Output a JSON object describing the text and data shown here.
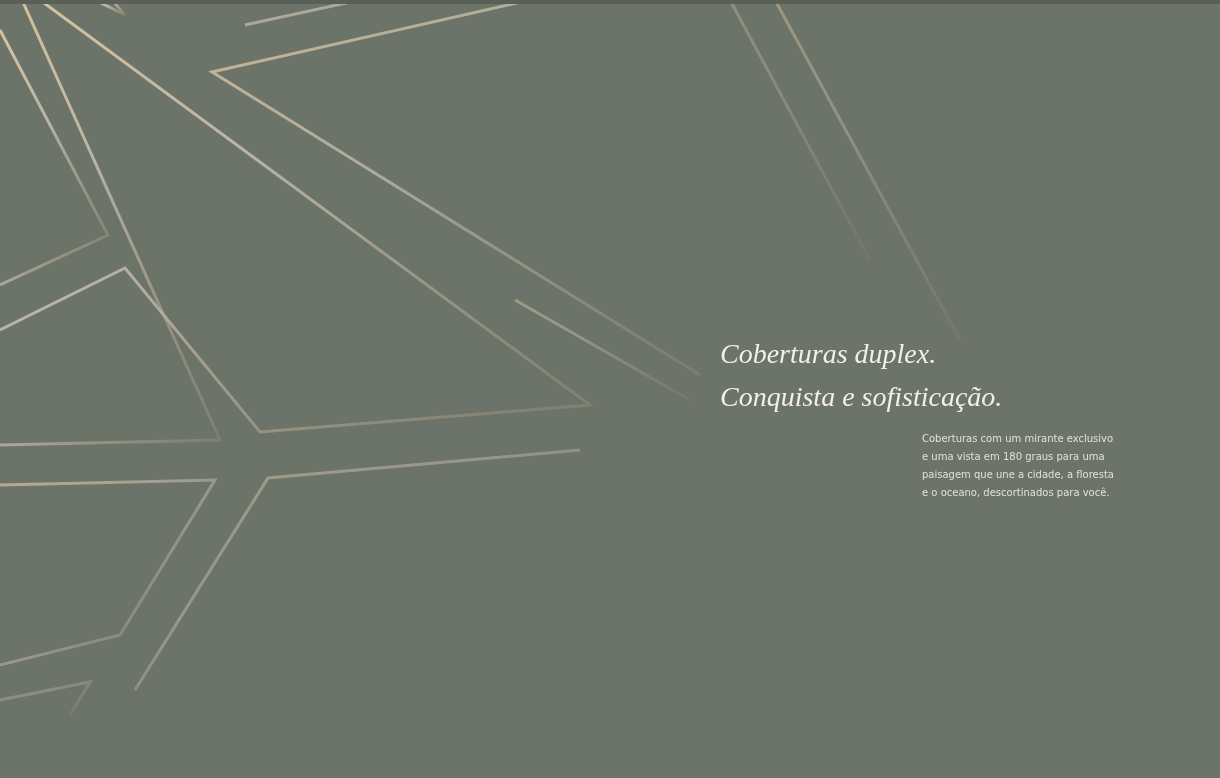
{
  "headline": [
    "Coberturas duplex.",
    "Conquista e sofisticação."
  ],
  "description": [
    "Coberturas com um mirante exclusivo",
    "e uma vista em 180 graus para uma",
    "paisagem que une a cidade, a floresta",
    "e o oceano, descortinados para você."
  ]
}
